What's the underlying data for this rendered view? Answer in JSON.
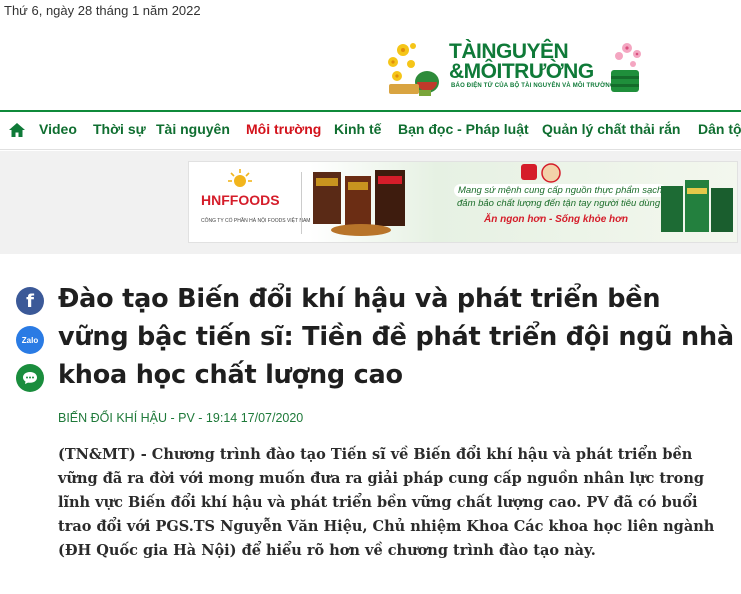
{
  "header": {
    "date": "Thứ 6, ngày 28 tháng 1 năm 2022",
    "logo": {
      "line1": "TÀINGUYÊN",
      "line2": "&MÔITRƯỜNG",
      "tagline": "BÁO ĐIỆN TỬ CỦA BỘ TÀI NGUYÊN VÀ MÔI TRƯỜNG"
    }
  },
  "nav": {
    "items": [
      {
        "label": "Video"
      },
      {
        "label": "Thời sự"
      },
      {
        "label": "Tài nguyên"
      },
      {
        "label": "Môi trường"
      },
      {
        "label": "Kinh tế"
      },
      {
        "label": "Bạn đọc - Pháp luật"
      },
      {
        "label": "Quản lý chất thải rắn"
      },
      {
        "label": "Dân tộ"
      }
    ],
    "active": "Môi trường"
  },
  "ad": {
    "brand": "HNFFOODS",
    "brand_sub": "CÔNG TY CỔ PHẦN HÀ NỘI FOODS VIỆT NAM",
    "slogan_1": "Mang sứ mệnh cung cấp nguồn thực phẩm sạch",
    "slogan_2": "đảm bảo chất lượng đến tận tay người tiêu dùng",
    "slogan_3": "Ăn ngon hơn - Sống khỏe hơn"
  },
  "share": {
    "zalo_label": "Zalo"
  },
  "article": {
    "title": "Đào tạo Biến đổi khí hậu và phát triển bền vững bậc tiến sĩ: Tiền đề phát triển đội ngũ nhà khoa học chất lượng cao",
    "meta": "BIẾN ĐỔI KHÍ HẬU - PV - 19:14 17/07/2020",
    "sapo": "(TN&MT) - Chương trình đào tạo Tiến sĩ về Biến đổi khí hậu và phát triển bền vững đã ra đời với mong muốn đưa ra giải pháp cung cấp nguồn nhân lực trong lĩnh vực Biến đổi khí hậu và phát triển bền vững chất lượng cao. PV đã có buổi trao đổi với PGS.TS Nguyễn Văn Hiệu, Chủ nhiệm Khoa Các khoa học liên ngành (ĐH Quốc gia Hà Nội) để hiểu rõ hơn về chương trình đào tạo này."
  },
  "colors": {
    "brand_green": "#0f7a38",
    "nav_active": "#d3121b",
    "facebook": "#3b5998",
    "zalo": "#2a7be4",
    "messenger": "#1a8d3d"
  }
}
